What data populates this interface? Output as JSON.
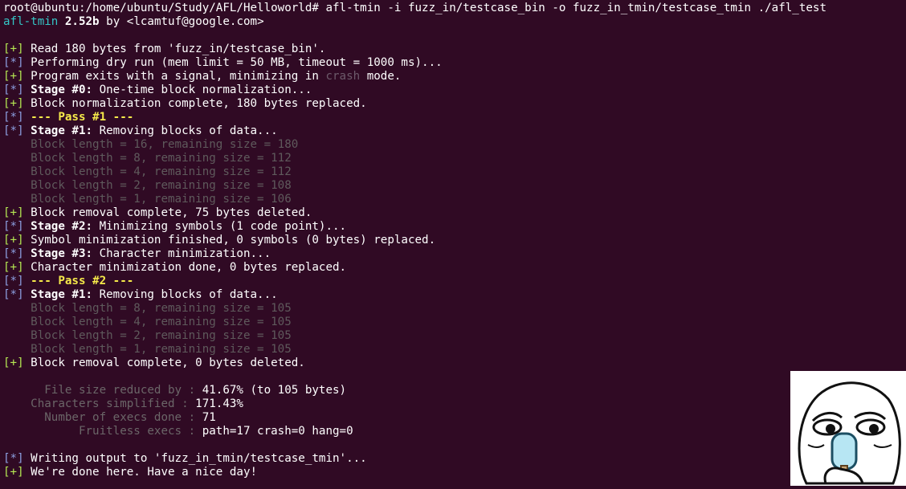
{
  "colors": {
    "background": "#300a24",
    "tag_plus": "#b5e853",
    "tag_star": "#8c9fe0",
    "block_gray": "#5f5a5c",
    "pass_yellow": "#f5e94a",
    "program_cyan": "#34c6c6"
  },
  "command": {
    "prompt": "root@ubuntu:/home/ubuntu/Study/AFL/Helloworld#",
    "text": " afl-tmin -i fuzz_in/testcase_bin -o fuzz_in_tmin/testcase_tmin ./afl_test"
  },
  "banner": {
    "program": "afl-tmin",
    "version": "2.52b",
    "by": " by <lcamtuf@google.com>"
  },
  "tags": {
    "plus": "[+]",
    "star": "[*]"
  },
  "log": {
    "read": "Read 180 bytes from 'fuzz_in/testcase_bin'.",
    "dry_run": "Performing dry run (mem limit = 50 MB, timeout = 1000 ms)...",
    "exits_pre": "Program exits with a signal, minimizing in ",
    "exits_word": "crash",
    "exits_post": " mode.",
    "stage0_label": "Stage #0:",
    "stage0_text": " One-time block normalization...",
    "norm_done": "Block normalization complete, 180 bytes replaced.",
    "pass1": "--- Pass #1 ---",
    "stage1_label": "Stage #1:",
    "stage1_text": " Removing blocks of data...",
    "p1_blocks": [
      "Block length = 16, remaining size = 180",
      "Block length = 8, remaining size = 112",
      "Block length = 4, remaining size = 112",
      "Block length = 2, remaining size = 108",
      "Block length = 1, remaining size = 106"
    ],
    "removal1": "Block removal complete, 75 bytes deleted.",
    "stage2_label": "Stage #2:",
    "stage2_text": " Minimizing symbols (1 code point)...",
    "symbol_done": "Symbol minimization finished, 0 symbols (0 bytes) replaced.",
    "stage3_label": "Stage #3:",
    "stage3_text": " Character minimization...",
    "char_done": "Character minimization done, 0 bytes replaced.",
    "pass2": "--- Pass #2 ---",
    "p2_blocks": [
      "Block length = 8, remaining size = 105",
      "Block length = 4, remaining size = 105",
      "Block length = 2, remaining size = 105",
      "Block length = 1, remaining size = 105"
    ],
    "removal2": "Block removal complete, 0 bytes deleted."
  },
  "stats": [
    {
      "label": "  File size reduced by : ",
      "value": "41.67% (to 105 bytes)"
    },
    {
      "label": "Characters simplified : ",
      "value": "171.43%"
    },
    {
      "label": "  Number of execs done : ",
      "value": "71"
    },
    {
      "label": "       Fruitless execs : ",
      "value": "path=17 crash=0 hang=0"
    }
  ],
  "final": {
    "writing": "Writing output to 'fuzz_in_tmin/testcase_tmin'...",
    "done": "We're done here. Have a nice day!"
  },
  "sticker": {
    "icon": "meme-face-popsicle"
  }
}
